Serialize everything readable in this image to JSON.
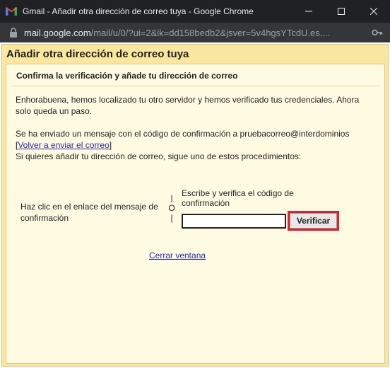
{
  "window": {
    "title": "Gmail - Añadir otra dirección de correo tuya - Google Chrome",
    "minimize_icon": "minimize-icon",
    "maximize_icon": "maximize-icon",
    "close_icon": "close-icon"
  },
  "addressbar": {
    "url_host": "mail.google.com",
    "url_path": "/mail/u/0/?ui=2&ik=dd158bedb2&jsver=5v4hgsYTcdU.es....",
    "lock_icon": "lock-icon",
    "key_icon": "key-icon"
  },
  "dialog": {
    "title": "Añadir otra dirección de correo tuya",
    "subtitle": "Confirma la verificación y añade tu dirección de correo",
    "paragraph1": "Enhorabuena, hemos localizado tu otro servidor y hemos verificado tus credenciales. Ahora solo queda un paso.",
    "sent_message": "Se ha enviado un mensaje con el código de confirmación a pruebacorreo@interdominios",
    "resend_link": "Volver a enviar el correo",
    "instructions": "Si quieres añadir tu dirección de correo, sigue uno de estos procedimientos:",
    "option_link": "Haz clic en el enlace del mensaje de confirmación",
    "or_separator": "O",
    "option_code_label": "Escribe y verifica el código de confirmación",
    "code_value": "",
    "verify_button": "Verificar",
    "close_link": "Cerrar ventana",
    "accent_color": "#e0202a"
  }
}
